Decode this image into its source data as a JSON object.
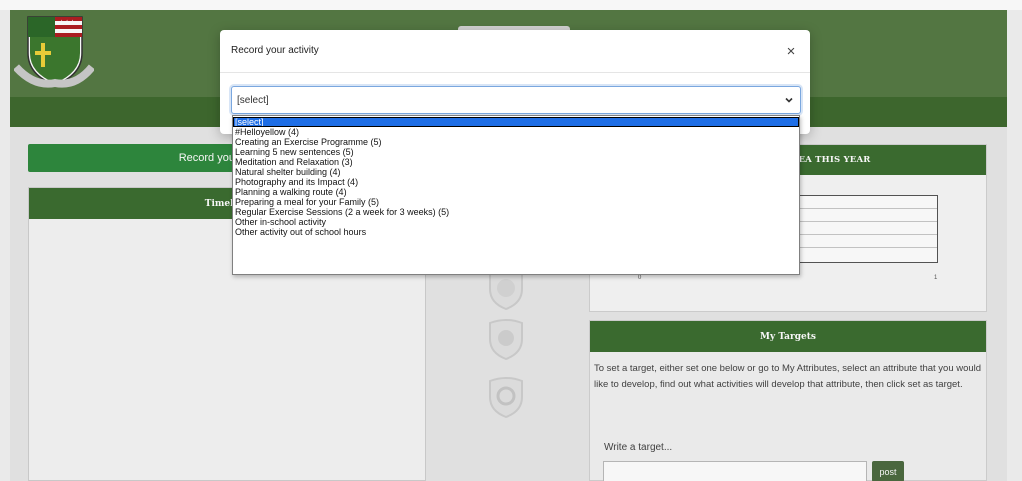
{
  "page": {
    "record_button_label": "Record your activity",
    "timeline_heading": "Timeline",
    "area_heading": "ACTIVITIES BY AREA THIS YEAR",
    "area_chart": {
      "x_ticks": [
        "0",
        "1"
      ]
    },
    "targets": {
      "heading": "My Targets",
      "description": "To set a target, either set one below or go to My Attributes, select an attribute that you would like to develop, find out what activities will develop that attribute, then click set as target.",
      "input_label": "Write a target...",
      "post_label": "post"
    }
  },
  "modal": {
    "title": "Record your activity",
    "close_glyph": "×",
    "select": {
      "value": "[select]",
      "options": [
        "[select]",
        "#Helloyellow (4)",
        "Creating an Exercise Programme (5)",
        "Learning 5 new sentences (5)",
        "Meditation and Relaxation (3)",
        "Natural shelter building (4)",
        "Photography and its Impact (4)",
        "Planning a walking route (4)",
        "Preparing a meal for your Family (5)",
        "Regular Exercise Sessions (2 a week for 3 weeks) (5)",
        "Other in-school activity",
        "Other activity out of school hours"
      ],
      "selected_index": 0
    }
  },
  "colors": {
    "header_green": "#567a45",
    "panel_head_green": "#3c6e31",
    "button_green": "#2f8a3e",
    "option_highlight": "#1e6ee6"
  }
}
